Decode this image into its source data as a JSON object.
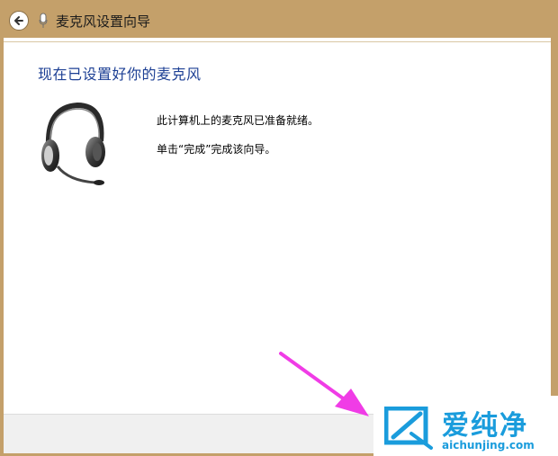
{
  "window": {
    "title": "麦克风设置向导"
  },
  "content": {
    "heading": "现在已设置好你的麦克风",
    "message_ready": "此计算机上的麦克风已准备就绪。",
    "message_finish": "单击“完成”完成该向导。"
  },
  "watermark": {
    "brand_cn": "爱纯净",
    "brand_en": "aichunjing.com"
  },
  "colors": {
    "titlebar": "#c4a06a",
    "heading": "#1c3f94",
    "watermark": "#1a9cdc",
    "arrow": "#f03ce6"
  },
  "icons": {
    "back": "back-arrow-icon",
    "app": "microphone-icon",
    "illustration": "headset-icon",
    "brand_logo": "logo-icon"
  }
}
